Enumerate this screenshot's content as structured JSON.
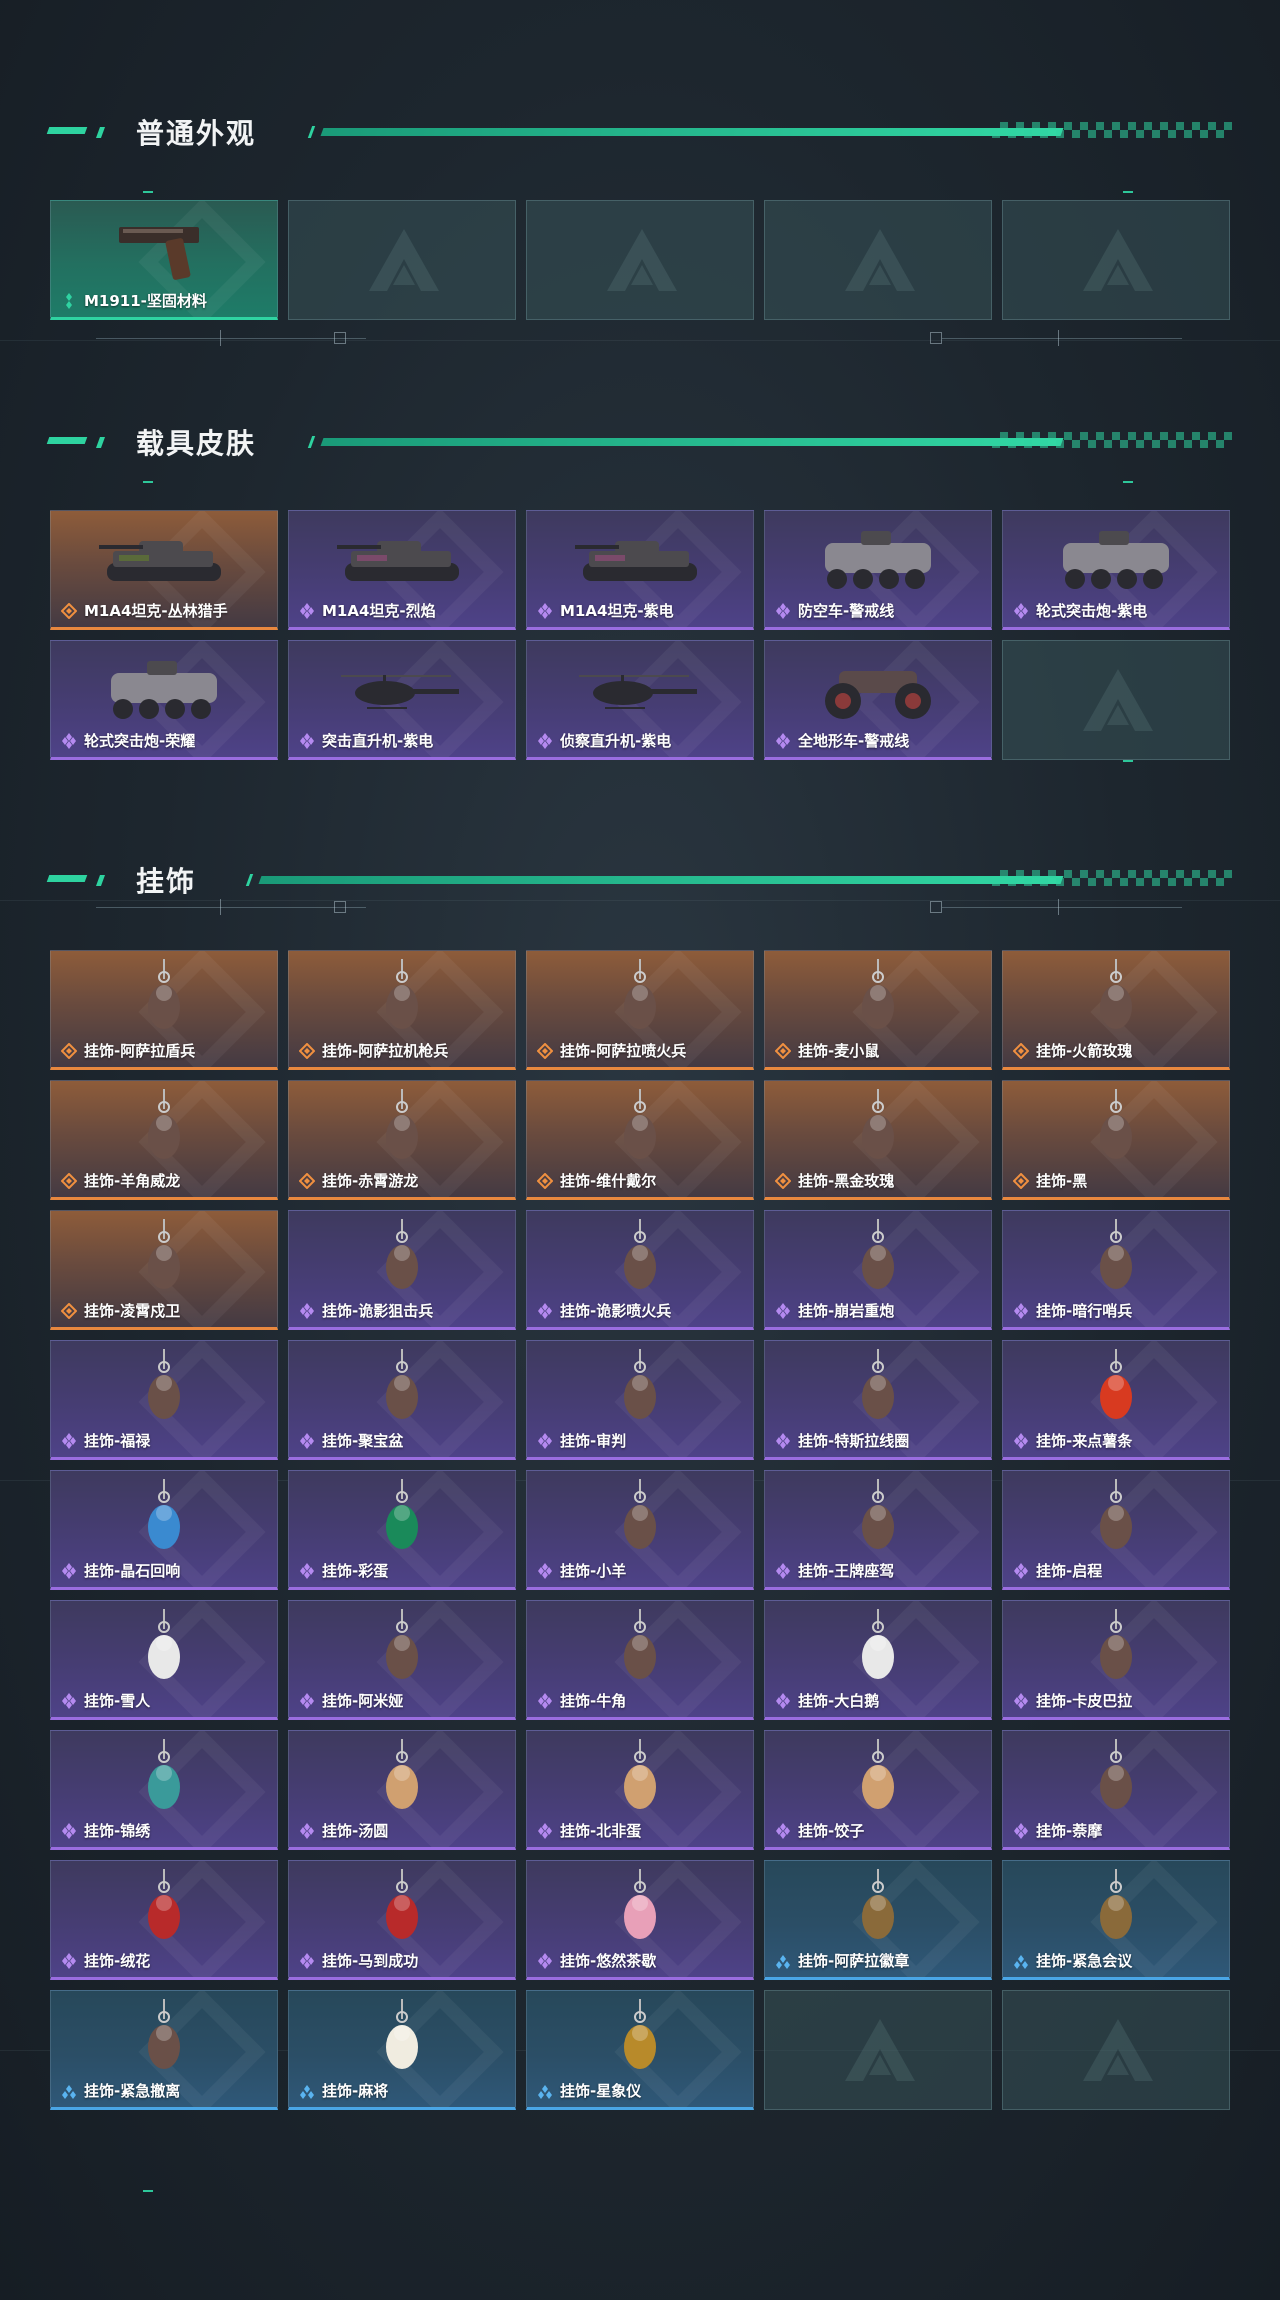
{
  "sections": [
    {
      "title": "普通外观",
      "items": [
        {
          "name": "M1911-坚固材料",
          "rarity": "green",
          "icon": "pistol-icon"
        },
        {
          "name": "",
          "rarity": "empty"
        },
        {
          "name": "",
          "rarity": "empty"
        },
        {
          "name": "",
          "rarity": "empty"
        },
        {
          "name": "",
          "rarity": "empty"
        }
      ]
    },
    {
      "title": "载具皮肤",
      "items": [
        {
          "name": "M1A4坦克-丛林猎手",
          "rarity": "orange",
          "icon": "tank-icon"
        },
        {
          "name": "M1A4坦克-烈焰",
          "rarity": "purple",
          "icon": "tank-icon"
        },
        {
          "name": "M1A4坦克-紫电",
          "rarity": "purple",
          "icon": "tank-icon"
        },
        {
          "name": "防空车-警戒线",
          "rarity": "purple",
          "icon": "armored-vehicle-icon"
        },
        {
          "name": "轮式突击炮-紫电",
          "rarity": "purple",
          "icon": "armored-vehicle-icon"
        },
        {
          "name": "轮式突击炮-荣耀",
          "rarity": "purple",
          "icon": "buggy-icon"
        },
        {
          "name": "突击直升机-紫电",
          "rarity": "purple",
          "icon": "helicopter-icon"
        },
        {
          "name": "侦察直升机-紫电",
          "rarity": "purple",
          "icon": "helicopter-icon"
        },
        {
          "name": "全地形车-警戒线",
          "rarity": "purple",
          "icon": "atv-icon"
        },
        {
          "name": "",
          "rarity": "empty"
        }
      ]
    },
    {
      "title": "挂饰",
      "items": [
        {
          "name": "挂饰-阿萨拉盾兵",
          "rarity": "orange",
          "icon": "figure-charm-icon"
        },
        {
          "name": "挂饰-阿萨拉机枪兵",
          "rarity": "orange",
          "icon": "figure-charm-icon"
        },
        {
          "name": "挂饰-阿萨拉喷火兵",
          "rarity": "orange",
          "icon": "figure-charm-icon"
        },
        {
          "name": "挂饰-麦小鼠",
          "rarity": "orange",
          "icon": "mouse-charm-icon"
        },
        {
          "name": "挂饰-火箭玫瑰",
          "rarity": "orange",
          "icon": "figure-charm-icon"
        },
        {
          "name": "挂饰-羊角威龙",
          "rarity": "orange",
          "icon": "figure-charm-icon"
        },
        {
          "name": "挂饰-赤霄游龙",
          "rarity": "orange",
          "icon": "figure-charm-icon"
        },
        {
          "name": "挂饰-维什戴尔",
          "rarity": "orange",
          "icon": "tag-charm-icon"
        },
        {
          "name": "挂饰-黑金玫瑰",
          "rarity": "orange",
          "icon": "rose-charm-icon"
        },
        {
          "name": "挂饰-黑",
          "rarity": "orange",
          "icon": "tag-charm-icon"
        },
        {
          "name": "挂饰-凌霄戍卫",
          "rarity": "orange",
          "icon": "figure-charm-icon"
        },
        {
          "name": "挂饰-诡影狙击兵",
          "rarity": "purple",
          "icon": "figure-charm-icon"
        },
        {
          "name": "挂饰-诡影喷火兵",
          "rarity": "purple",
          "icon": "figure-charm-icon"
        },
        {
          "name": "挂饰-崩岩重炮",
          "rarity": "purple",
          "icon": "figure-charm-icon"
        },
        {
          "name": "挂饰-暗行哨兵",
          "rarity": "purple",
          "icon": "figure-charm-icon"
        },
        {
          "name": "挂饰-福禄",
          "rarity": "purple",
          "icon": "gourd-charm-icon"
        },
        {
          "name": "挂饰-聚宝盆",
          "rarity": "purple",
          "icon": "treasure-bowl-charm-icon"
        },
        {
          "name": "挂饰-审判",
          "rarity": "purple",
          "icon": "tag-charm-icon"
        },
        {
          "name": "挂饰-特斯拉线圈",
          "rarity": "purple",
          "icon": "coil-charm-icon"
        },
        {
          "name": "挂饰-来点薯条",
          "rarity": "purple",
          "icon": "fries-charm-icon"
        },
        {
          "name": "挂饰-晶石回响",
          "rarity": "purple",
          "icon": "crystal-charm-icon"
        },
        {
          "name": "挂饰-彩蛋",
          "rarity": "purple",
          "icon": "egg-charm-icon"
        },
        {
          "name": "挂饰-小羊",
          "rarity": "purple",
          "icon": "sheep-charm-icon"
        },
        {
          "name": "挂饰-王牌座驾",
          "rarity": "purple",
          "icon": "plane-charm-icon"
        },
        {
          "name": "挂饰-启程",
          "rarity": "purple",
          "icon": "ring-charm-icon"
        },
        {
          "name": "挂饰-雪人",
          "rarity": "purple",
          "icon": "snowman-charm-icon"
        },
        {
          "name": "挂饰-阿米娅",
          "rarity": "purple",
          "icon": "figure-charm-icon"
        },
        {
          "name": "挂饰-牛角",
          "rarity": "purple",
          "icon": "horn-charm-icon"
        },
        {
          "name": "挂饰-大白鹅",
          "rarity": "purple",
          "icon": "goose-charm-icon"
        },
        {
          "name": "挂饰-卡皮巴拉",
          "rarity": "purple",
          "icon": "capybara-charm-icon"
        },
        {
          "name": "挂饰-锦绣",
          "rarity": "purple",
          "icon": "butterfly-charm-icon"
        },
        {
          "name": "挂饰-汤圆",
          "rarity": "purple",
          "icon": "round-charm-icon"
        },
        {
          "name": "挂饰-北非蛋",
          "rarity": "purple",
          "icon": "round-charm-icon"
        },
        {
          "name": "挂饰-饺子",
          "rarity": "purple",
          "icon": "round-charm-icon"
        },
        {
          "name": "挂饰-萘摩",
          "rarity": "purple",
          "icon": "figure-charm-icon"
        },
        {
          "name": "挂饰-绒花",
          "rarity": "purple",
          "icon": "flower-charm-icon"
        },
        {
          "name": "挂饰-马到成功",
          "rarity": "purple",
          "icon": "horse-charm-icon"
        },
        {
          "name": "挂饰-悠然茶歇",
          "rarity": "purple",
          "icon": "cupcake-charm-icon"
        },
        {
          "name": "挂饰-阿萨拉徽章",
          "rarity": "blue",
          "icon": "badge-charm-icon"
        },
        {
          "name": "挂饰-紧急会议",
          "rarity": "blue",
          "icon": "badge-charm-icon"
        },
        {
          "name": "挂饰-紧急撤离",
          "rarity": "blue",
          "icon": "tag-charm-icon"
        },
        {
          "name": "挂饰-麻将",
          "rarity": "blue",
          "icon": "mahjong-charm-icon"
        },
        {
          "name": "挂饰-星象仪",
          "rarity": "blue",
          "icon": "astrolabe-charm-icon"
        },
        {
          "name": "",
          "rarity": "empty"
        },
        {
          "name": "",
          "rarity": "empty"
        }
      ]
    }
  ],
  "colors": {
    "accent": "#2ed3a0",
    "orange": "#e8883f",
    "purple": "#9a6de0",
    "blue": "#4aa6e6",
    "green": "#2fd3a2"
  }
}
